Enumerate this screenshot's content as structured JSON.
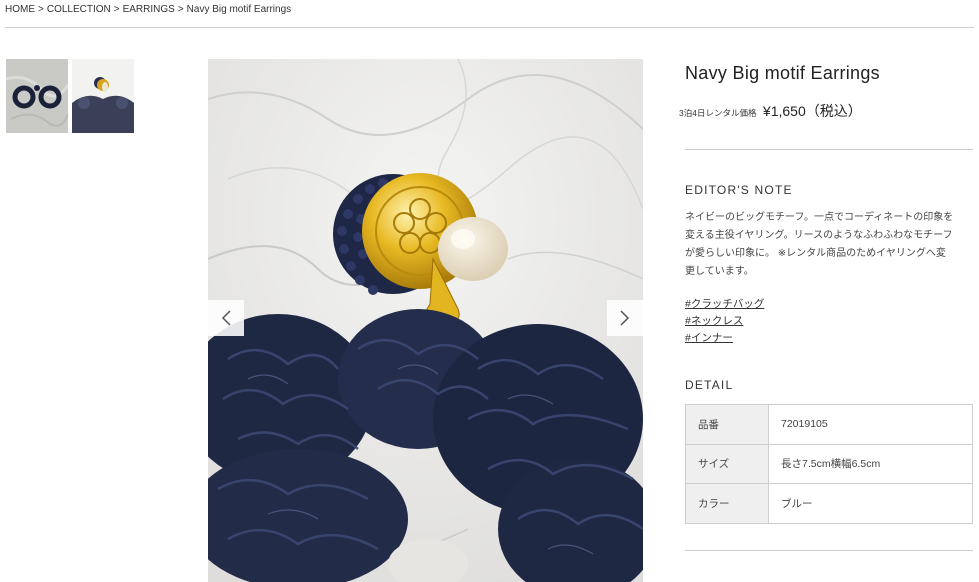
{
  "breadcrumb": {
    "items": [
      "HOME",
      "COLLECTION",
      "EARRINGS",
      "Navy Big motif Earrings"
    ],
    "separator": ">"
  },
  "product": {
    "title": "Navy Big motif Earrings",
    "price_label": "3泊4日レンタル価格",
    "price": "¥1,650（税込）"
  },
  "gallery": {
    "thumbnails": [
      "thumbnail-front",
      "thumbnail-side"
    ],
    "prev_icon": "chevron-left-icon",
    "next_icon": "chevron-right-icon"
  },
  "editors_note": {
    "heading": "EDITOR'S NOTE",
    "lines": [
      "ネイビーのビッグモチーフ。一点でコーディネートの印象を",
      "変える主役イヤリング。リースのようなふわふわなモチーフ",
      "が愛らしい印象に。 ※レンタル商品のためイヤリングへ変",
      "更しています。"
    ],
    "tags": [
      "#クラッチバッグ",
      "#ネックレス",
      "#インナー"
    ]
  },
  "detail": {
    "heading": "DETAIL",
    "rows": [
      {
        "label": "品番",
        "value": "72019105"
      },
      {
        "label": "サイズ",
        "value": "長さ7.5cm横幅6.5cm"
      },
      {
        "label": "カラー",
        "value": "ブルー"
      }
    ]
  },
  "colors": {
    "navy": "#1e2742",
    "gold": "#d4a017",
    "rule": "#cfcfcf",
    "table_label_bg": "#efefef"
  }
}
